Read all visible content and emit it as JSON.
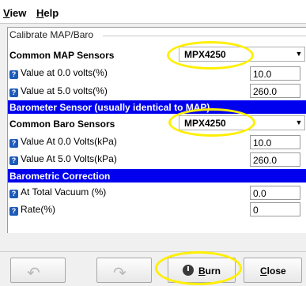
{
  "menu": [
    {
      "label": "View",
      "mnemonic": "V",
      "rest": "iew"
    },
    {
      "label": "Help",
      "mnemonic": "H",
      "rest": "elp"
    }
  ],
  "group_title": "Calibrate MAP/Baro",
  "map": {
    "label": "Common MAP Sensors",
    "sensor": "MPX4250",
    "v0_label": "Value at 0.0 volts(%)",
    "v0_value": "10.0",
    "v5_label": "Value at 5.0 volts(%)",
    "v5_value": "260.0"
  },
  "baro_section": "Barometer Sensor (usually identical to MAP)",
  "baro": {
    "label": "Common Baro Sensors",
    "sensor": "MPX4250",
    "v0_label": "Value At 0.0 Volts(kPa)",
    "v0_value": "10.0",
    "v5_label": "Value At 5.0 Volts(kPa)",
    "v5_value": "260.0"
  },
  "correction_section": "Barometric Correction",
  "correction": {
    "vac_label": "At Total Vacuum (%)",
    "vac_value": "0.0",
    "rate_label": "Rate(%)",
    "rate_value": "0"
  },
  "buttons": {
    "burn_mnemonic": "B",
    "burn_rest": "urn",
    "close_mnemonic": "C",
    "close_rest": "lose"
  },
  "icons": {
    "help": "?",
    "dropdown": "▼",
    "spin_up": "▲",
    "spin_down": "▼"
  },
  "colors": {
    "section_bar": "#0000ee",
    "highlight_ring": "#ffef00"
  }
}
